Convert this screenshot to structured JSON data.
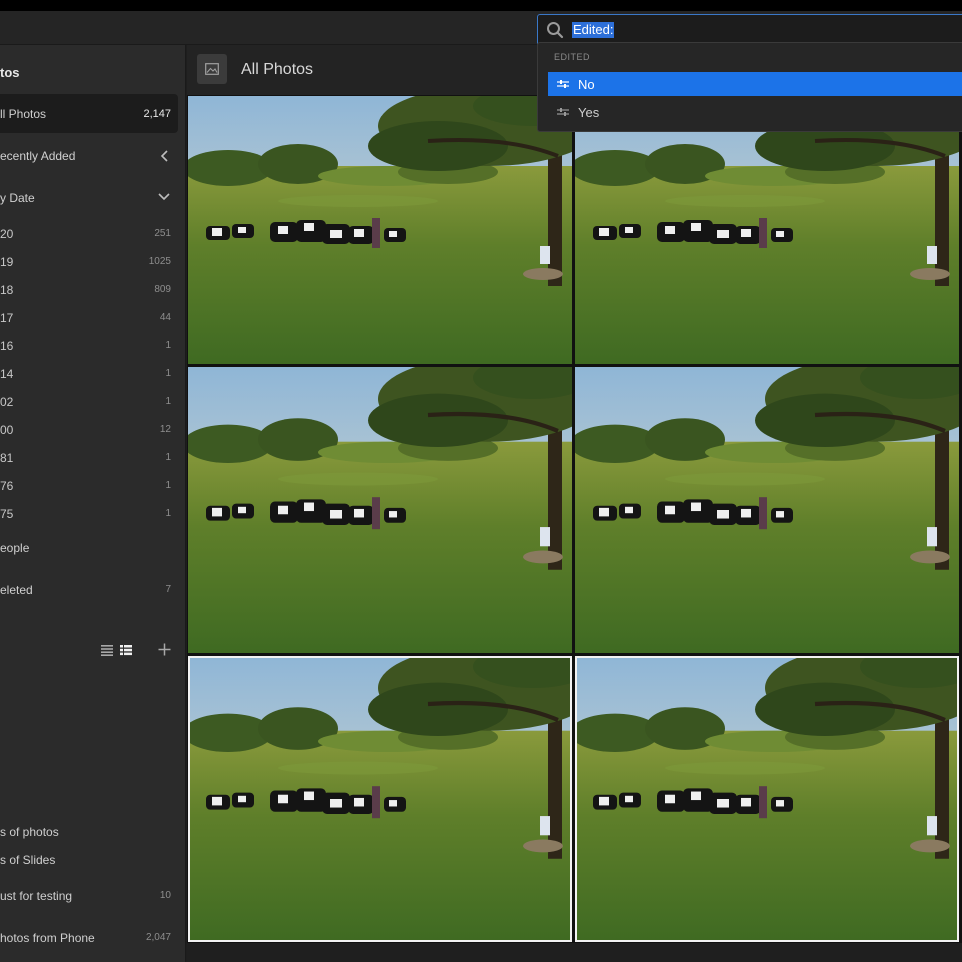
{
  "search": {
    "value": "Edited:"
  },
  "dropdown": {
    "heading": "EDITED",
    "options": [
      {
        "label": "No",
        "selected": true
      },
      {
        "label": "Yes",
        "selected": false
      }
    ]
  },
  "sidebar": {
    "title": "tos",
    "nav": [
      {
        "label": "ll Photos",
        "count": "2,147"
      },
      {
        "label": "ecently Added"
      },
      {
        "label": "y Date"
      }
    ],
    "years": [
      {
        "label": "20",
        "count": "251"
      },
      {
        "label": "19",
        "count": "1025"
      },
      {
        "label": "18",
        "count": "809"
      },
      {
        "label": "17",
        "count": "44"
      },
      {
        "label": "16",
        "count": "1"
      },
      {
        "label": "14",
        "count": "1"
      },
      {
        "label": "02",
        "count": "1"
      },
      {
        "label": "00",
        "count": "12"
      },
      {
        "label": "81",
        "count": "1"
      },
      {
        "label": "76",
        "count": "1"
      },
      {
        "label": "75",
        "count": "1"
      }
    ],
    "people": "eople",
    "deleted": {
      "label": "eleted",
      "count": "7"
    },
    "albums": [
      {
        "label": "s of photos"
      },
      {
        "label": "s of Slides"
      },
      {
        "label": "ust for testing",
        "count": "10"
      },
      {
        "label": "hotos from Phone",
        "count": "2,047"
      }
    ]
  },
  "main": {
    "title": "All Photos"
  },
  "colors": {
    "accent": "#1c73e8",
    "search_border": "#3a78c8",
    "sidebar_bg": "#2b2b2b"
  },
  "photos": [
    {
      "name": "cows-field-photo-1",
      "selected": false
    },
    {
      "name": "cows-field-photo-2",
      "selected": false
    },
    {
      "name": "cows-field-photo-3",
      "selected": false
    },
    {
      "name": "cows-field-photo-4",
      "selected": false
    },
    {
      "name": "cows-field-photo-5",
      "selected": true
    },
    {
      "name": "cows-field-photo-6",
      "selected": true
    }
  ]
}
